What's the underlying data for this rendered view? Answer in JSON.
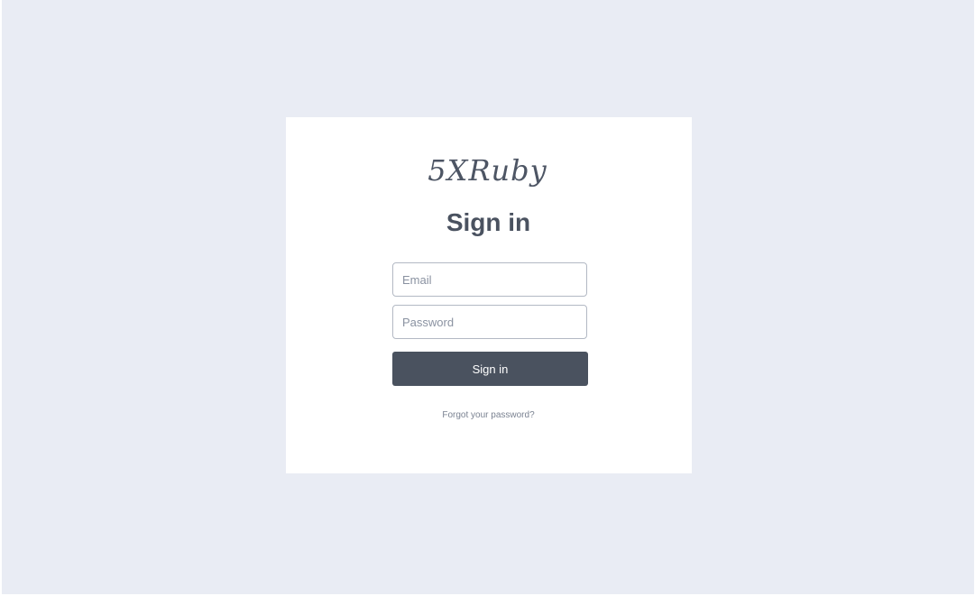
{
  "brand": {
    "logo_text": "5XRuby"
  },
  "signin": {
    "title": "Sign in",
    "email_placeholder": "Email",
    "email_value": "",
    "password_placeholder": "Password",
    "password_value": "",
    "submit_label": "Sign in",
    "forgot_link": "Forgot your password?"
  },
  "colors": {
    "page_background": "#e9ecf4",
    "card_background": "#ffffff",
    "button_background": "#4a525f",
    "text_primary": "#4a5260",
    "text_muted": "#7a8291"
  }
}
